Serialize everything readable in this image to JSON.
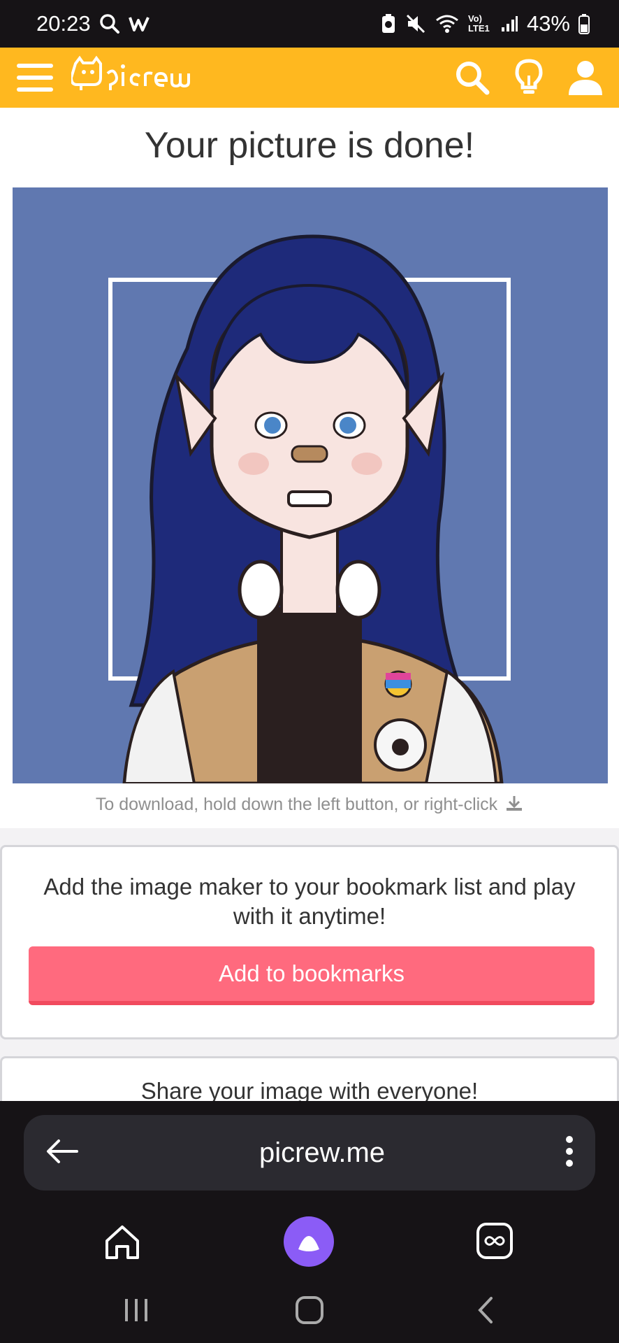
{
  "status_bar": {
    "time": "20:23",
    "battery": "43%",
    "network_label": "Vo) LTE1"
  },
  "header": {
    "logo_text": "Picrew"
  },
  "main": {
    "title": "Your picture is done!",
    "download_hint": "To download, hold down the left button, or right-click",
    "bookmark_card": {
      "text": "Add the image maker to your bookmark list and play with it anytime!",
      "button_label": "Add to bookmarks"
    },
    "share_card": {
      "text": "Share your image with everyone!"
    }
  },
  "browser": {
    "url": "picrew.me"
  },
  "colors": {
    "header": "#FFB81F",
    "button": "#FF6A7E",
    "picture_bg": "#6078B0",
    "assistant": "#8B5CF6"
  }
}
